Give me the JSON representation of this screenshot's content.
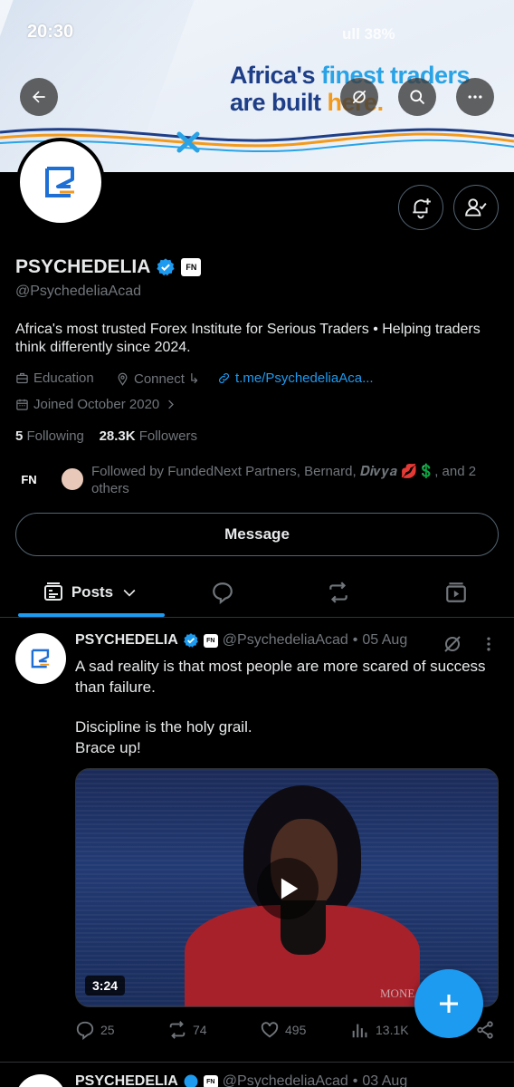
{
  "status_bar": {
    "time": "20:30",
    "signal_text": "ull 38%"
  },
  "banner": {
    "line1_a": "Africa's ",
    "line1_b": "finest traders",
    "line2_a": "are built ",
    "line2_b": "here."
  },
  "profile": {
    "name": "PSYCHEDELIA",
    "affiliate_badge": "FN",
    "handle": "@PsychedeliaAcad",
    "bio": "Africa's most trusted Forex Institute for Serious Traders • Helping traders think differently since 2024.",
    "category": "Education",
    "location": "Connect ↳",
    "link": "t.me/PsychedeliaAca...",
    "joined": "Joined October 2020",
    "following_count": "5",
    "following_label": "Following",
    "followers_count": "28.3K",
    "followers_label": "Followers",
    "followed_by": "Followed by FundedNext Partners, Bernard, 𝑫𝒊𝒗𝒚𝒂 💋💲, and 2 others",
    "fn_logo": "FN",
    "message_label": "Message"
  },
  "tabs": {
    "posts_label": "Posts"
  },
  "post": {
    "author": "PSYCHEDELIA",
    "badge": "FN",
    "handle": "@PsychedeliaAcad",
    "dot": "•",
    "date": "05 Aug",
    "text_p1": "A sad reality is that most people are more scared of success than failure.",
    "text_p2": "Discipline is the holy grail.",
    "text_p3": "Brace up!",
    "video_duration": "3:24",
    "video_watermark": "MONE",
    "replies": "25",
    "reposts": "74",
    "likes": "495",
    "views": "13.1K"
  },
  "next_post": {
    "author": "PSYCHEDELIA",
    "badge": "FN",
    "handle": "@PsychedeliaAcad",
    "dot": "•",
    "date": "03 Aug"
  },
  "colors": {
    "accent": "#1d9bf0",
    "text": "#e7e9ea",
    "muted": "#71767b",
    "border": "#2f3336"
  },
  "icons": [
    "back-arrow-icon",
    "grok-icon",
    "search-icon",
    "more-icon",
    "bell-plus-icon",
    "user-check-icon",
    "verified-icon",
    "briefcase-icon",
    "location-icon",
    "link-icon",
    "calendar-icon",
    "chevron-right-icon",
    "posts-icon",
    "chevron-down-icon",
    "replies-icon",
    "repost-icon",
    "media-icon",
    "play-icon",
    "reply-icon",
    "like-icon",
    "views-icon",
    "share-icon",
    "plus-icon"
  ]
}
